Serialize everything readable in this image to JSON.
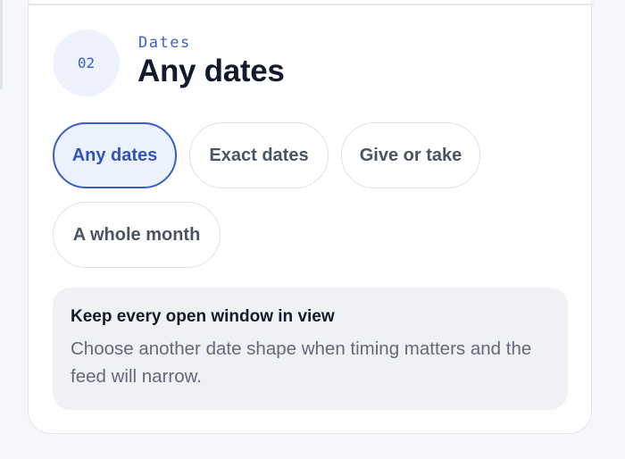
{
  "step": {
    "number": "02",
    "eyebrow": "Dates",
    "title": "Any dates"
  },
  "options": [
    {
      "label": "Any dates",
      "selected": true
    },
    {
      "label": "Exact dates",
      "selected": false
    },
    {
      "label": "Give or take",
      "selected": false
    },
    {
      "label": "A whole month",
      "selected": false
    }
  ],
  "note": {
    "title": "Keep every open window in view",
    "body": "Choose another date shape when timing matters and the feed will narrow."
  },
  "colors": {
    "accent": "#3a5fc4",
    "selected_bg": "#ebf1fd",
    "title": "#121b2e"
  }
}
